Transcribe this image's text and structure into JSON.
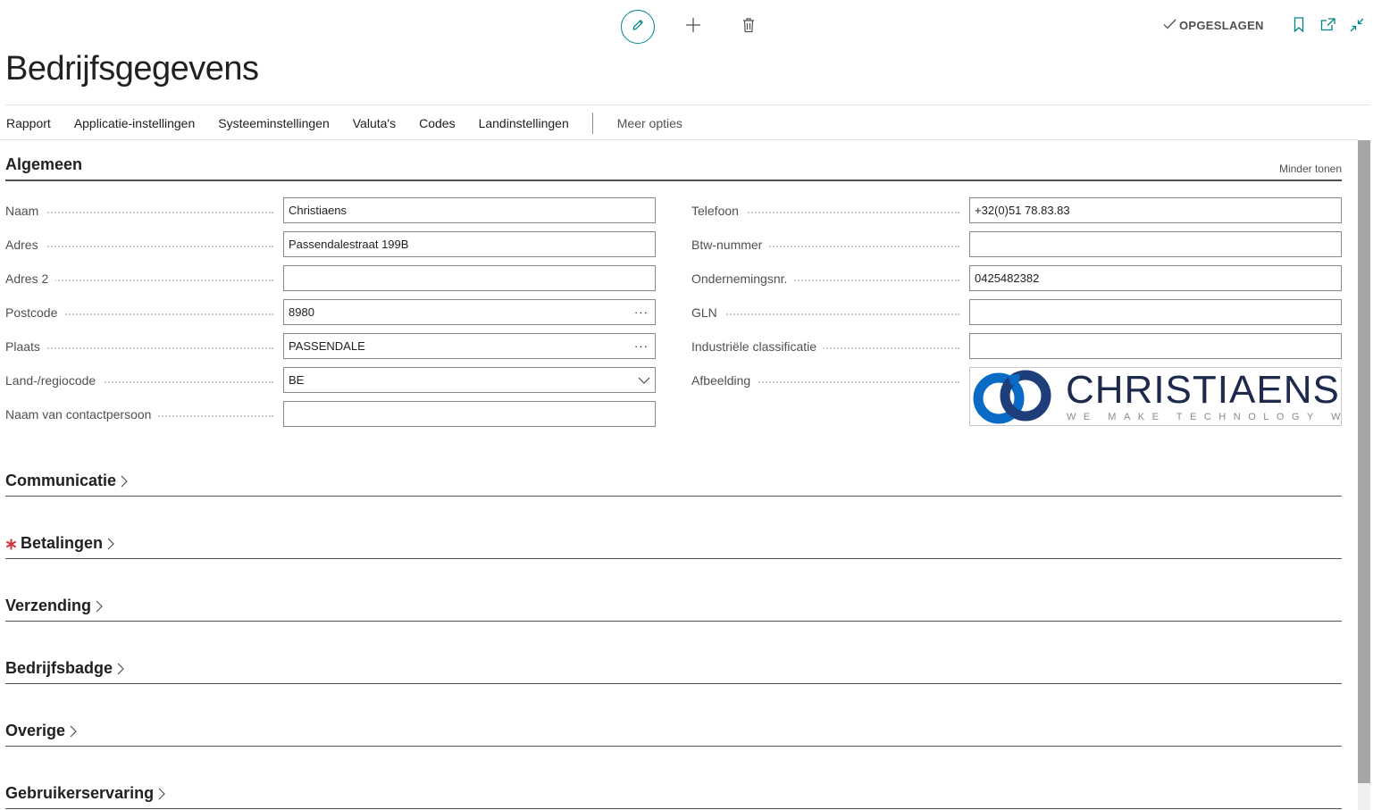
{
  "topbar": {
    "saved_label": "OPGESLAGEN"
  },
  "page": {
    "title": "Bedrijfsgegevens"
  },
  "actions": [
    {
      "label": "Rapport"
    },
    {
      "label": "Applicatie-instellingen"
    },
    {
      "label": "Systeeminstellingen"
    },
    {
      "label": "Valuta's"
    },
    {
      "label": "Codes"
    },
    {
      "label": "Landinstellingen"
    }
  ],
  "actions_more": "Meer opties",
  "general": {
    "title": "Algemeen",
    "less_label": "Minder tonen",
    "left_fields": [
      {
        "label": "Naam",
        "value": "Christiaens"
      },
      {
        "label": "Adres",
        "value": "Passendalestraat 199B"
      },
      {
        "label": "Adres 2",
        "value": ""
      },
      {
        "label": "Postcode",
        "value": "8980"
      },
      {
        "label": "Plaats",
        "value": "PASSENDALE"
      },
      {
        "label": "Land-/regiocode",
        "value": "BE"
      },
      {
        "label": "Naam van contactpersoon",
        "value": ""
      }
    ],
    "right_fields": [
      {
        "label": "Telefoon",
        "value": "+32(0)51 78.83.83"
      },
      {
        "label": "Btw-nummer",
        "value": ""
      },
      {
        "label": "Ondernemingsnr.",
        "value": "0425482382"
      },
      {
        "label": "GLN",
        "value": ""
      },
      {
        "label": "Industriële classificatie",
        "value": ""
      },
      {
        "label": "Afbeelding",
        "value": ""
      }
    ],
    "logo": {
      "name": "CHRISTIAENS",
      "tagline": "WE MAKE TECHNOLOGY WORK",
      "colors": {
        "primary": "#1d2a4d",
        "accent": "#0a6bc7"
      }
    }
  },
  "sections": [
    {
      "title": "Communicatie",
      "required": false
    },
    {
      "title": "Betalingen",
      "required": true
    },
    {
      "title": "Verzending",
      "required": false
    },
    {
      "title": "Bedrijfsbadge",
      "required": false
    },
    {
      "title": "Overige",
      "required": false
    },
    {
      "title": "Gebruikerservaring",
      "required": false
    }
  ],
  "icons": {
    "edit": "pencil-icon",
    "new": "plus-icon",
    "delete": "trash-icon",
    "saved": "checkmark-icon",
    "bookmark": "bookmark-icon",
    "open_new": "open-in-new-window-icon",
    "collapse": "collapse-icon",
    "lookup": "ellipsis-icon",
    "dropdown": "chevron-down-icon",
    "section": "chevron-right-icon"
  },
  "colors": {
    "accent": "#008489",
    "required": "#d13438",
    "text": "#212121",
    "muted": "#505050"
  }
}
